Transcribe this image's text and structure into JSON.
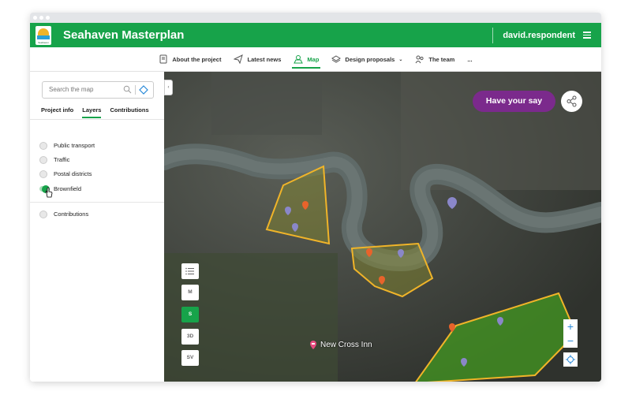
{
  "header": {
    "logo_text": "Seahaven",
    "title": "Seahaven Masterplan",
    "user": "david.respondent"
  },
  "nav": {
    "items": [
      {
        "label": "About the project",
        "icon": "document-icon"
      },
      {
        "label": "Latest news",
        "icon": "paper-plane-icon"
      },
      {
        "label": "Map",
        "icon": "map-icon",
        "active": true
      },
      {
        "label": "Design proposals",
        "icon": "layers-icon",
        "dropdown": true
      },
      {
        "label": "The team",
        "icon": "team-icon"
      }
    ],
    "more": "..."
  },
  "sidebar": {
    "search_placeholder": "Search the map",
    "tabs": [
      "Project info",
      "Layers",
      "Contributions"
    ],
    "active_tab": "Layers",
    "layers": [
      {
        "label": "Public transport",
        "on": false
      },
      {
        "label": "Traffic",
        "on": false
      },
      {
        "label": "Postal districts",
        "on": false
      },
      {
        "label": "Brownfield",
        "on": true
      }
    ],
    "contributions": {
      "label": "Contributions",
      "on": false
    }
  },
  "map": {
    "cta": "Have your say",
    "view_buttons": [
      "M",
      "S",
      "3D",
      "SV"
    ],
    "selected_view": "S",
    "zoom_in": "+",
    "zoom_out": "−",
    "place_label": "New Cross Inn",
    "colors": {
      "brand_green": "#17a34a",
      "cta_purple": "#7b2a8c",
      "area_outline": "#f0b429"
    }
  }
}
